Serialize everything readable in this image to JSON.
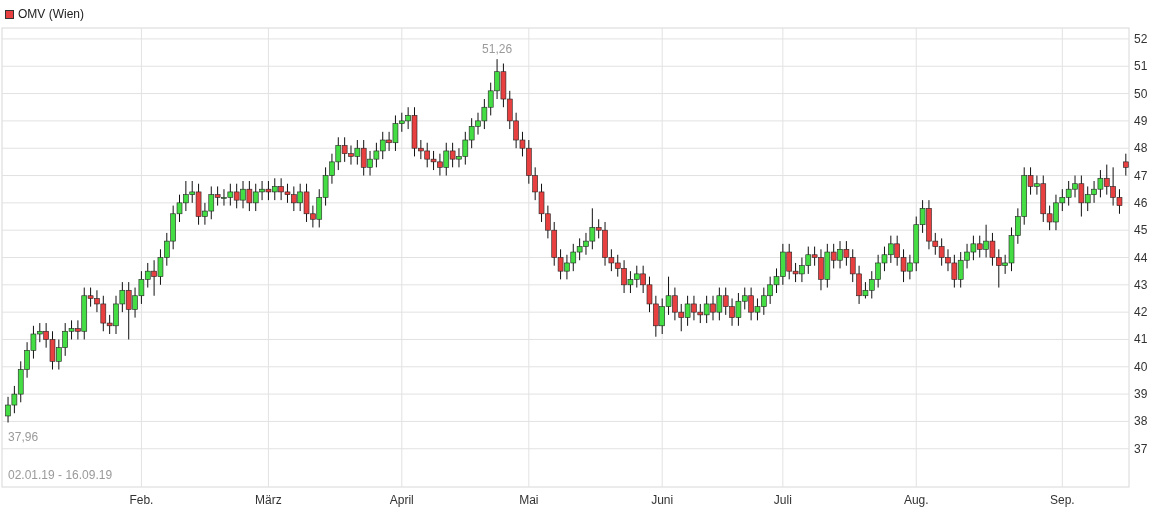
{
  "legend": {
    "label": "OMV (Wien)",
    "color": "#e84040"
  },
  "chart": {
    "date_range": "02.01.19 - 16.09.19",
    "chart_data": {
      "type": "candlestick",
      "categories": [
        null,
        null,
        null,
        null,
        null,
        null,
        null,
        null,
        null,
        null,
        null,
        null,
        null,
        null,
        null,
        null,
        null,
        null,
        null,
        null,
        null,
        "Feb.",
        null,
        null,
        null,
        null,
        null,
        null,
        null,
        null,
        null,
        null,
        null,
        null,
        null,
        null,
        null,
        null,
        null,
        null,
        null,
        "März",
        null,
        null,
        null,
        null,
        null,
        null,
        null,
        null,
        null,
        null,
        null,
        null,
        null,
        null,
        null,
        null,
        null,
        null,
        null,
        null,
        "April",
        null,
        null,
        null,
        null,
        null,
        null,
        null,
        null,
        null,
        null,
        null,
        null,
        null,
        null,
        null,
        null,
        null,
        null,
        null,
        "Mai",
        null,
        null,
        null,
        null,
        null,
        null,
        null,
        null,
        null,
        null,
        null,
        null,
        null,
        null,
        null,
        null,
        null,
        null,
        null,
        null,
        "Juni",
        null,
        null,
        null,
        null,
        null,
        null,
        null,
        null,
        null,
        null,
        null,
        null,
        null,
        null,
        null,
        null,
        null,
        null,
        "Juli",
        null,
        null,
        null,
        null,
        null,
        null,
        null,
        null,
        null,
        null,
        null,
        null,
        null,
        null,
        null,
        null,
        null,
        null,
        null,
        null,
        "Aug.",
        null,
        null,
        null,
        null,
        null,
        null,
        null,
        null,
        null,
        null,
        null,
        null,
        null,
        null,
        null,
        null,
        null,
        null,
        null,
        null,
        null,
        null,
        "Sep.",
        null,
        null,
        null,
        null,
        null,
        null,
        null,
        null,
        null,
        null
      ],
      "ylim": [
        35.6,
        52.4
      ],
      "yticks": [
        37,
        38,
        39,
        40,
        41,
        42,
        43,
        44,
        45,
        46,
        47,
        48,
        49,
        50,
        51,
        52
      ],
      "grid": true,
      "annotations": [
        "51,26",
        "37,96"
      ],
      "ohlc": [
        [
          38.2,
          38.9,
          37.96,
          38.6
        ],
        [
          38.6,
          39.3,
          38.3,
          39.0
        ],
        [
          39.0,
          40.2,
          38.7,
          39.9
        ],
        [
          39.9,
          40.9,
          39.6,
          40.6
        ],
        [
          40.6,
          41.5,
          40.3,
          41.2
        ],
        [
          41.2,
          41.6,
          40.9,
          41.3
        ],
        [
          41.3,
          41.6,
          40.7,
          41.0
        ],
        [
          41.0,
          41.3,
          39.9,
          40.2
        ],
        [
          40.2,
          41.0,
          39.9,
          40.7
        ],
        [
          40.7,
          41.6,
          40.4,
          41.3
        ],
        [
          41.3,
          41.7,
          41.0,
          41.4
        ],
        [
          41.4,
          41.7,
          41.0,
          41.3
        ],
        [
          41.3,
          42.9,
          41.0,
          42.6
        ],
        [
          42.6,
          42.9,
          42.2,
          42.5
        ],
        [
          42.5,
          42.8,
          42.0,
          42.3
        ],
        [
          42.3,
          42.6,
          41.3,
          41.6
        ],
        [
          41.6,
          41.9,
          41.2,
          41.5
        ],
        [
          41.5,
          42.6,
          41.2,
          42.3
        ],
        [
          42.3,
          43.1,
          42.0,
          42.8
        ],
        [
          42.8,
          43.1,
          41.0,
          42.1
        ],
        [
          42.1,
          42.9,
          41.8,
          42.6
        ],
        [
          42.6,
          43.5,
          42.3,
          43.2
        ],
        [
          43.2,
          43.8,
          42.9,
          43.5
        ],
        [
          43.5,
          43.9,
          42.6,
          43.3
        ],
        [
          43.3,
          44.3,
          43.0,
          44.0
        ],
        [
          44.0,
          44.9,
          43.7,
          44.6
        ],
        [
          44.6,
          45.9,
          44.3,
          45.6
        ],
        [
          45.6,
          46.3,
          45.3,
          46.0
        ],
        [
          46.0,
          46.8,
          45.7,
          46.3
        ],
        [
          46.3,
          46.8,
          46.0,
          46.4
        ],
        [
          46.4,
          46.7,
          45.2,
          45.5
        ],
        [
          45.5,
          46.0,
          45.2,
          45.7
        ],
        [
          45.7,
          46.6,
          45.4,
          46.3
        ],
        [
          46.3,
          46.6,
          45.9,
          46.2
        ],
        [
          46.2,
          46.5,
          45.9,
          46.2
        ],
        [
          46.2,
          46.7,
          45.9,
          46.4
        ],
        [
          46.4,
          46.7,
          45.8,
          46.1
        ],
        [
          46.1,
          46.8,
          45.8,
          46.5
        ],
        [
          46.5,
          46.8,
          45.7,
          46.0
        ],
        [
          46.0,
          46.7,
          45.7,
          46.4
        ],
        [
          46.4,
          46.8,
          46.1,
          46.5
        ],
        [
          46.5,
          46.8,
          46.1,
          46.4
        ],
        [
          46.4,
          46.9,
          46.1,
          46.6
        ],
        [
          46.6,
          46.9,
          46.1,
          46.4
        ],
        [
          46.4,
          46.7,
          46.0,
          46.3
        ],
        [
          46.3,
          46.6,
          45.7,
          46.0
        ],
        [
          46.0,
          46.7,
          45.7,
          46.4
        ],
        [
          46.4,
          46.7,
          45.3,
          45.6
        ],
        [
          45.6,
          45.9,
          45.1,
          45.4
        ],
        [
          45.4,
          46.5,
          45.1,
          46.2
        ],
        [
          46.2,
          47.3,
          45.9,
          47.0
        ],
        [
          47.0,
          47.8,
          46.7,
          47.5
        ],
        [
          47.5,
          48.4,
          47.2,
          48.1
        ],
        [
          48.1,
          48.4,
          47.5,
          47.8
        ],
        [
          47.8,
          48.1,
          47.4,
          47.7
        ],
        [
          47.7,
          48.3,
          47.4,
          48.0
        ],
        [
          48.0,
          48.3,
          47.0,
          47.3
        ],
        [
          47.3,
          47.9,
          47.0,
          47.6
        ],
        [
          47.6,
          48.2,
          47.3,
          47.9
        ],
        [
          47.9,
          48.6,
          47.6,
          48.3
        ],
        [
          48.3,
          48.6,
          47.9,
          48.2
        ],
        [
          48.2,
          49.2,
          47.9,
          48.9
        ],
        [
          48.9,
          49.3,
          48.6,
          49.0
        ],
        [
          49.0,
          49.5,
          48.7,
          49.2
        ],
        [
          49.2,
          49.5,
          47.7,
          48.0
        ],
        [
          48.0,
          48.3,
          47.6,
          47.9
        ],
        [
          47.9,
          48.2,
          47.3,
          47.6
        ],
        [
          47.6,
          47.9,
          47.2,
          47.5
        ],
        [
          47.5,
          47.8,
          47.0,
          47.3
        ],
        [
          47.3,
          48.2,
          47.0,
          47.9
        ],
        [
          47.9,
          48.2,
          47.3,
          47.6
        ],
        [
          47.6,
          48.0,
          47.3,
          47.7
        ],
        [
          47.7,
          48.6,
          47.4,
          48.3
        ],
        [
          48.3,
          49.1,
          48.0,
          48.8
        ],
        [
          48.8,
          49.3,
          48.5,
          49.0
        ],
        [
          49.0,
          49.8,
          48.7,
          49.5
        ],
        [
          49.5,
          50.4,
          49.2,
          50.1
        ],
        [
          50.1,
          51.26,
          49.8,
          50.8
        ],
        [
          50.8,
          51.1,
          49.5,
          49.8
        ],
        [
          49.8,
          50.1,
          48.7,
          49.0
        ],
        [
          49.0,
          49.3,
          48.0,
          48.3
        ],
        [
          48.3,
          48.6,
          47.7,
          48.0
        ],
        [
          48.0,
          48.3,
          46.7,
          47.0
        ],
        [
          47.0,
          47.3,
          46.1,
          46.4
        ],
        [
          46.4,
          46.7,
          45.3,
          45.6
        ],
        [
          45.6,
          45.9,
          44.7,
          45.0
        ],
        [
          45.0,
          45.3,
          43.7,
          44.0
        ],
        [
          44.0,
          44.3,
          43.2,
          43.5
        ],
        [
          43.5,
          44.1,
          43.2,
          43.8
        ],
        [
          43.8,
          44.5,
          43.5,
          44.2
        ],
        [
          44.2,
          44.7,
          43.9,
          44.4
        ],
        [
          44.4,
          44.9,
          44.1,
          44.6
        ],
        [
          44.6,
          45.8,
          44.3,
          45.1
        ],
        [
          45.1,
          45.4,
          44.7,
          45.0
        ],
        [
          45.0,
          45.3,
          43.7,
          44.0
        ],
        [
          44.0,
          44.3,
          43.5,
          43.8
        ],
        [
          43.8,
          44.1,
          43.3,
          43.6
        ],
        [
          43.6,
          43.9,
          42.7,
          43.0
        ],
        [
          43.0,
          43.5,
          42.7,
          43.2
        ],
        [
          43.2,
          43.7,
          42.9,
          43.4
        ],
        [
          43.4,
          43.7,
          42.7,
          43.0
        ],
        [
          43.0,
          43.3,
          42.0,
          42.3
        ],
        [
          42.3,
          42.6,
          41.1,
          41.5
        ],
        [
          41.5,
          42.5,
          41.2,
          42.2
        ],
        [
          42.2,
          43.3,
          41.9,
          42.6
        ],
        [
          42.6,
          42.9,
          41.7,
          42.0
        ],
        [
          42.0,
          42.3,
          41.3,
          41.8
        ],
        [
          41.8,
          42.6,
          41.5,
          42.3
        ],
        [
          42.3,
          42.6,
          41.7,
          42.0
        ],
        [
          42.0,
          42.3,
          41.6,
          41.9
        ],
        [
          41.9,
          42.6,
          41.6,
          42.3
        ],
        [
          42.3,
          42.6,
          41.7,
          42.0
        ],
        [
          42.0,
          42.9,
          41.7,
          42.6
        ],
        [
          42.6,
          42.9,
          41.9,
          42.2
        ],
        [
          42.2,
          42.5,
          41.5,
          41.8
        ],
        [
          41.8,
          42.7,
          41.5,
          42.4
        ],
        [
          42.4,
          42.9,
          42.1,
          42.6
        ],
        [
          42.6,
          42.9,
          41.7,
          42.0
        ],
        [
          42.0,
          42.5,
          41.7,
          42.2
        ],
        [
          42.2,
          42.9,
          41.9,
          42.6
        ],
        [
          42.6,
          43.3,
          42.3,
          43.0
        ],
        [
          43.0,
          43.6,
          42.7,
          43.3
        ],
        [
          43.3,
          44.5,
          43.0,
          44.2
        ],
        [
          44.2,
          44.5,
          43.2,
          43.5
        ],
        [
          43.5,
          43.8,
          43.1,
          43.4
        ],
        [
          43.4,
          44.0,
          43.1,
          43.7
        ],
        [
          43.7,
          44.4,
          43.4,
          44.1
        ],
        [
          44.1,
          44.4,
          43.7,
          44.0
        ],
        [
          44.0,
          44.3,
          42.8,
          43.2
        ],
        [
          43.2,
          44.5,
          42.9,
          44.2
        ],
        [
          44.2,
          44.5,
          43.6,
          43.9
        ],
        [
          43.9,
          44.6,
          43.6,
          44.3
        ],
        [
          44.3,
          44.6,
          43.7,
          44.0
        ],
        [
          44.0,
          44.3,
          43.1,
          43.4
        ],
        [
          43.4,
          43.7,
          42.3,
          42.6
        ],
        [
          42.6,
          43.1,
          42.5,
          42.8
        ],
        [
          42.8,
          43.5,
          42.5,
          43.2
        ],
        [
          43.2,
          44.1,
          42.9,
          43.8
        ],
        [
          43.8,
          44.4,
          43.5,
          44.1
        ],
        [
          44.1,
          44.8,
          43.8,
          44.5
        ],
        [
          44.5,
          44.8,
          43.7,
          44.0
        ],
        [
          44.0,
          44.3,
          43.1,
          43.5
        ],
        [
          43.5,
          44.1,
          43.2,
          43.8
        ],
        [
          43.8,
          45.5,
          43.5,
          45.2
        ],
        [
          45.2,
          46.1,
          44.9,
          45.8
        ],
        [
          45.8,
          46.1,
          44.3,
          44.6
        ],
        [
          44.6,
          44.9,
          44.1,
          44.4
        ],
        [
          44.4,
          44.7,
          43.7,
          44.0
        ],
        [
          44.0,
          44.3,
          43.5,
          43.8
        ],
        [
          43.8,
          44.1,
          42.9,
          43.2
        ],
        [
          43.2,
          44.2,
          42.9,
          43.9
        ],
        [
          43.9,
          44.5,
          43.6,
          44.2
        ],
        [
          44.2,
          44.8,
          43.9,
          44.5
        ],
        [
          44.5,
          44.8,
          44.0,
          44.3
        ],
        [
          44.3,
          45.2,
          44.0,
          44.6
        ],
        [
          44.6,
          44.9,
          43.7,
          44.0
        ],
        [
          44.0,
          44.3,
          42.9,
          43.7
        ],
        [
          43.7,
          44.1,
          43.4,
          43.8
        ],
        [
          43.8,
          45.1,
          43.5,
          44.8
        ],
        [
          44.8,
          45.8,
          44.5,
          45.5
        ],
        [
          45.5,
          47.3,
          45.2,
          47.0
        ],
        [
          47.0,
          47.3,
          46.3,
          46.6
        ],
        [
          46.6,
          47.0,
          46.3,
          46.7
        ],
        [
          46.7,
          47.0,
          45.3,
          45.6
        ],
        [
          45.6,
          45.9,
          45.0,
          45.3
        ],
        [
          45.3,
          46.3,
          45.0,
          46.0
        ],
        [
          46.0,
          46.5,
          45.7,
          46.2
        ],
        [
          46.2,
          46.8,
          45.9,
          46.5
        ],
        [
          46.5,
          47.0,
          46.2,
          46.7
        ],
        [
          46.7,
          47.0,
          45.5,
          46.0
        ],
        [
          46.0,
          46.6,
          45.7,
          46.3
        ],
        [
          46.3,
          46.8,
          46.0,
          46.5
        ],
        [
          46.5,
          47.2,
          46.2,
          46.9
        ],
        [
          46.9,
          47.4,
          46.3,
          46.6
        ],
        [
          46.6,
          47.3,
          45.9,
          46.2
        ],
        [
          46.2,
          46.5,
          45.6,
          45.9
        ],
        [
          47.5,
          47.8,
          47.0,
          47.3
        ]
      ]
    }
  }
}
